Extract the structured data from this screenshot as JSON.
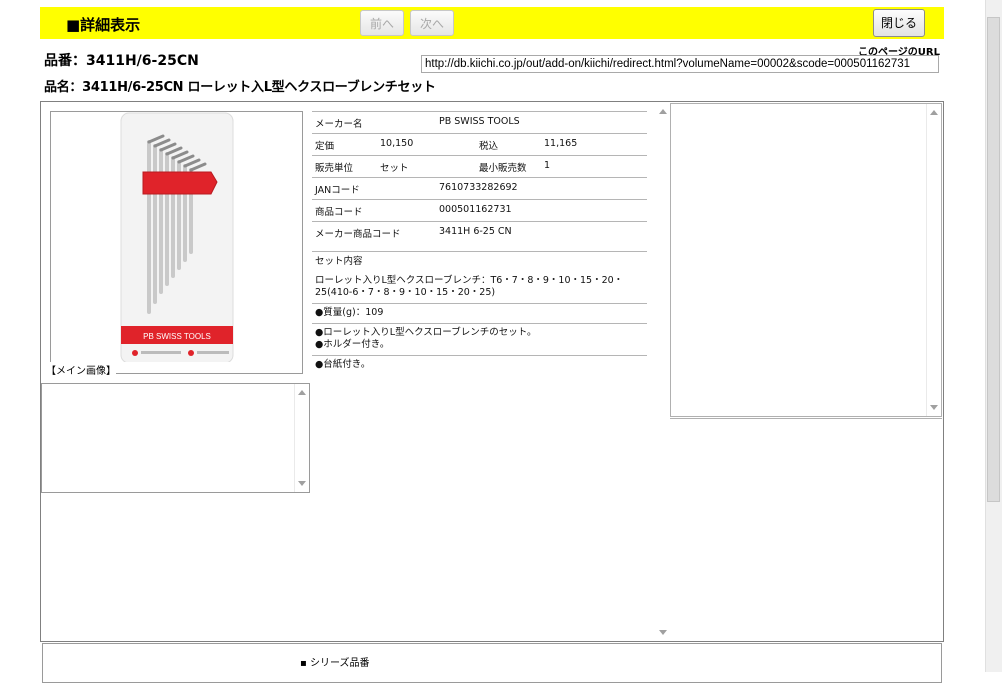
{
  "header": {
    "title": "■詳細表示",
    "prev_label": "前へ",
    "next_label": "次へ",
    "close_label": "閉じる"
  },
  "product": {
    "part_number": "品番：3411H/6-25CN",
    "part_name": "品名：3411H/6-25CN ローレット入L型ヘクスローブレンチセット"
  },
  "page_url": {
    "label": "このページのURL",
    "value": "http://db.kiichi.co.jp/out/add-on/kiichi/redirect.html?volumeName=00002&scode=000501162731"
  },
  "image": {
    "caption": "【メイン画像】",
    "brand_text": "PB SWISS TOOLS",
    "brand_color": "#e0232a"
  },
  "spec": {
    "maker_label": "メーカー名",
    "maker_value": "PB SWISS TOOLS",
    "list_price_label": "定価",
    "list_price_value": "10,150",
    "tax_label": "税込",
    "tax_value": "11,165",
    "unit_label": "販売単位",
    "unit_value": "セット",
    "min_qty_label": "最小販売数",
    "min_qty_value": "1",
    "jan_label": "JANコード",
    "jan_value": "7610733282692",
    "code_label": "商品コード",
    "code_value": "000501162731",
    "maker_code_label": "メーカー商品コード",
    "maker_code_value": "3411H 6-25 CN",
    "set_label": "セット内容",
    "set_value": "ローレット入りL型ヘクスローブレンチ：T6・7・8・9・10・15・20・25(410-6・7・8・9・10・15・20・25)",
    "weight": "●質量(g)：109",
    "feature_1": "●ローレット入りL型ヘクスローブレンチのセット。",
    "feature_2": "●ホルダー付き。",
    "feature_3": "●台紙付き。"
  },
  "bottom": {
    "series_label": "シリーズ品番"
  }
}
